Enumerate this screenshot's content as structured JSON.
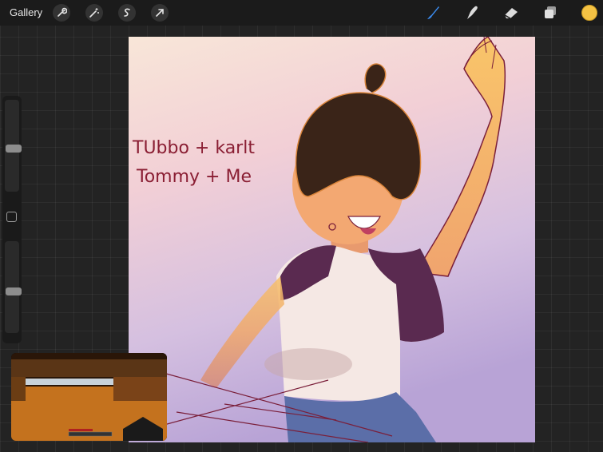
{
  "topbar": {
    "gallery_label": "Gallery",
    "left_tools": [
      "wrench-icon",
      "magic-wand-icon",
      "selection-icon",
      "transform-arrow-icon"
    ],
    "right_tools": [
      "brush-icon",
      "smudge-icon",
      "eraser-icon",
      "layers-icon"
    ],
    "active_tool": "brush-icon",
    "current_color": "#f5c344"
  },
  "sidebar": {
    "brush_size_level": 0.53,
    "opacity_level": 0.55
  },
  "canvas": {
    "handwriting_line1": "TUbbo + karlt",
    "handwriting_line2": "Tommy + Me"
  },
  "colors": {
    "accent_blue": "#3b8cf0",
    "handwriting": "#8a1e33"
  }
}
